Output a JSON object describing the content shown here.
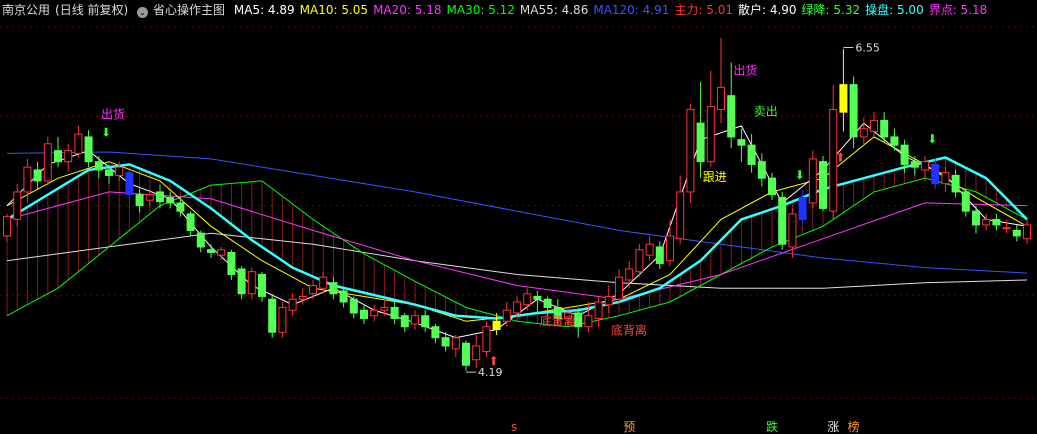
{
  "header": {
    "stock": "南京公用",
    "mode": "(日线 前复权)",
    "dropdown_glyph": "⌄",
    "indicator": "省心操作主图",
    "indicators": [
      {
        "label": "MA5:",
        "value": "4.89",
        "color": "#ffffff"
      },
      {
        "label": "MA10:",
        "value": "5.05",
        "color": "#ffff00"
      },
      {
        "label": "MA20:",
        "value": "5.18",
        "color": "#ff33ff"
      },
      {
        "label": "MA30:",
        "value": "5.12",
        "color": "#00ff00"
      },
      {
        "label": "MA55:",
        "value": "4.86",
        "color": "#dddddd"
      },
      {
        "label": "MA120:",
        "value": "4.91",
        "color": "#3355ff"
      },
      {
        "label": "主力:",
        "value": "5.01",
        "color": "#ff3333"
      },
      {
        "label": "散户:",
        "value": "4.90",
        "color": "#ffffff"
      },
      {
        "label": "绿降:",
        "value": "5.32",
        "color": "#33ff33"
      },
      {
        "label": "操盘:",
        "value": "5.00",
        "color": "#33ffff"
      },
      {
        "label": "界点:",
        "value": "5.18",
        "color": "#ff33ff"
      }
    ]
  },
  "colors": {
    "background": "#000000",
    "up": "#ff3232",
    "down": "#54ff54",
    "grid": "#7a0000",
    "ma5": "#ffffff",
    "ma10": "#ffff00",
    "ma20": "#ff33ff",
    "ma30": "#00ff00",
    "ma55": "#dddddd",
    "ma120": "#3355ff",
    "caopan": "#33ffff",
    "mark_yellow": "#ffff00",
    "mark_blue": "#2233ff",
    "label_pink": "#ff33ff",
    "label_red": "#ff4444",
    "label_green": "#33ff33",
    "label_yellow": "#ffff00",
    "label_orange": "#ff9933",
    "label_white": "#e6e6e6"
  },
  "chart_data": {
    "type": "candlestick",
    "ylim": [
      3.9,
      6.75
    ],
    "grid_levels": [
      4.0,
      4.75,
      5.4,
      6.05,
      6.7
    ],
    "candles": [
      [
        5.18,
        5.32,
        5.34,
        5.14
      ],
      [
        5.3,
        5.5,
        5.56,
        5.25
      ],
      [
        5.5,
        5.68,
        5.74,
        5.42
      ],
      [
        5.66,
        5.58,
        5.72,
        5.52
      ],
      [
        5.58,
        5.85,
        5.9,
        5.55
      ],
      [
        5.8,
        5.72,
        5.9,
        5.68
      ],
      [
        5.72,
        5.8,
        5.85,
        5.65
      ],
      [
        5.78,
        5.92,
        5.98,
        5.75
      ],
      [
        5.9,
        5.72,
        5.95,
        5.68
      ],
      [
        5.72,
        5.66,
        5.76,
        5.6
      ],
      [
        5.66,
        5.62,
        5.7,
        5.56
      ],
      [
        5.62,
        5.68,
        5.72,
        5.58
      ],
      [
        5.64,
        5.48,
        5.66,
        5.44
      ],
      [
        5.48,
        5.4,
        5.52,
        5.35
      ],
      [
        5.44,
        5.48,
        5.52,
        5.4
      ],
      [
        5.5,
        5.43,
        5.55,
        5.38
      ],
      [
        5.46,
        5.42,
        5.5,
        5.38
      ],
      [
        5.42,
        5.36,
        5.46,
        5.32
      ],
      [
        5.34,
        5.22,
        5.36,
        5.18
      ],
      [
        5.2,
        5.1,
        5.22,
        5.06
      ],
      [
        5.08,
        5.06,
        5.12,
        5.02
      ],
      [
        5.04,
        5.08,
        5.1,
        5.0
      ],
      [
        5.06,
        4.9,
        5.08,
        4.86
      ],
      [
        4.94,
        4.76,
        4.96,
        4.72
      ],
      [
        4.76,
        4.92,
        4.95,
        4.72
      ],
      [
        4.9,
        4.74,
        4.92,
        4.7
      ],
      [
        4.72,
        4.48,
        4.76,
        4.44
      ],
      [
        4.48,
        4.66,
        4.7,
        4.44
      ],
      [
        4.64,
        4.72,
        4.76,
        4.6
      ],
      [
        4.72,
        4.74,
        4.8,
        4.68
      ],
      [
        4.76,
        4.82,
        4.86,
        4.72
      ],
      [
        4.8,
        4.88,
        4.92,
        4.76
      ],
      [
        4.84,
        4.76,
        4.88,
        4.72
      ],
      [
        4.78,
        4.7,
        4.8,
        4.66
      ],
      [
        4.72,
        4.62,
        4.74,
        4.58
      ],
      [
        4.64,
        4.58,
        4.68,
        4.54
      ],
      [
        4.6,
        4.64,
        4.68,
        4.56
      ],
      [
        4.64,
        4.66,
        4.72,
        4.6
      ],
      [
        4.66,
        4.58,
        4.7,
        4.54
      ],
      [
        4.6,
        4.52,
        4.62,
        4.48
      ],
      [
        4.54,
        4.6,
        4.64,
        4.5
      ],
      [
        4.6,
        4.52,
        4.64,
        4.48
      ],
      [
        4.52,
        4.44,
        4.54,
        4.4
      ],
      [
        4.44,
        4.38,
        4.48,
        4.34
      ],
      [
        4.36,
        4.44,
        4.46,
        4.3
      ],
      [
        4.4,
        4.24,
        4.42,
        4.2
      ],
      [
        4.28,
        4.38,
        4.46,
        4.22
      ],
      [
        4.34,
        4.52,
        4.56,
        4.3
      ],
      [
        4.5,
        4.56,
        4.62,
        4.46
      ],
      [
        4.56,
        4.64,
        4.7,
        4.52
      ],
      [
        4.62,
        4.7,
        4.74,
        4.58
      ],
      [
        4.68,
        4.76,
        4.8,
        4.64
      ],
      [
        4.74,
        4.72,
        4.78,
        4.62
      ],
      [
        4.72,
        4.66,
        4.74,
        4.6
      ],
      [
        4.66,
        4.58,
        4.72,
        4.54
      ],
      [
        4.58,
        4.62,
        4.66,
        4.52
      ],
      [
        4.62,
        4.52,
        4.66,
        4.44
      ],
      [
        4.52,
        4.6,
        4.7,
        4.48
      ],
      [
        4.58,
        4.7,
        4.74,
        4.52
      ],
      [
        4.68,
        4.74,
        4.82,
        4.62
      ],
      [
        4.72,
        4.88,
        4.94,
        4.68
      ],
      [
        4.86,
        4.94,
        5.0,
        4.8
      ],
      [
        4.92,
        5.08,
        5.12,
        4.88
      ],
      [
        5.04,
        5.12,
        5.18,
        5.0
      ],
      [
        5.1,
        4.98,
        5.14,
        4.94
      ],
      [
        5.0,
        5.18,
        5.3,
        4.96
      ],
      [
        5.16,
        5.5,
        5.62,
        5.12
      ],
      [
        5.5,
        6.1,
        6.14,
        5.42
      ],
      [
        6.0,
        5.72,
        6.3,
        5.6
      ],
      [
        5.72,
        6.12,
        6.38,
        5.68
      ],
      [
        6.1,
        6.26,
        6.62,
        6.0
      ],
      [
        6.2,
        5.9,
        6.44,
        5.82
      ],
      [
        5.88,
        5.84,
        5.96,
        5.72
      ],
      [
        5.84,
        5.7,
        5.92,
        5.64
      ],
      [
        5.72,
        5.6,
        5.78,
        5.54
      ],
      [
        5.6,
        5.48,
        5.64,
        5.44
      ],
      [
        5.46,
        5.12,
        5.5,
        5.08
      ],
      [
        5.1,
        5.34,
        5.38,
        5.02
      ],
      [
        5.3,
        5.46,
        5.52,
        5.26
      ],
      [
        5.42,
        5.74,
        5.8,
        5.38
      ],
      [
        5.72,
        5.38,
        5.76,
        5.36
      ],
      [
        5.36,
        6.1,
        6.28,
        5.3
      ],
      [
        6.08,
        6.28,
        6.54,
        5.94
      ],
      [
        6.28,
        5.9,
        6.34,
        5.82
      ],
      [
        5.9,
        5.96,
        6.04,
        5.84
      ],
      [
        5.94,
        6.02,
        6.08,
        5.9
      ],
      [
        6.02,
        5.9,
        6.08,
        5.86
      ],
      [
        5.9,
        5.84,
        5.96,
        5.8
      ],
      [
        5.84,
        5.7,
        5.88,
        5.64
      ],
      [
        5.72,
        5.68,
        5.76,
        5.62
      ],
      [
        5.66,
        5.72,
        5.76,
        5.58
      ],
      [
        5.7,
        5.56,
        5.74,
        5.52
      ],
      [
        5.56,
        5.64,
        5.68,
        5.5
      ],
      [
        5.62,
        5.5,
        5.66,
        5.46
      ],
      [
        5.5,
        5.36,
        5.52,
        5.32
      ],
      [
        5.36,
        5.26,
        5.4,
        5.2
      ],
      [
        5.26,
        5.3,
        5.34,
        5.22
      ],
      [
        5.3,
        5.26,
        5.34,
        5.22
      ],
      [
        5.24,
        5.24,
        5.3,
        5.2
      ],
      [
        5.22,
        5.18,
        5.26,
        5.14
      ],
      [
        5.16,
        5.26,
        5.3,
        5.12
      ]
    ],
    "marked_candles": [
      {
        "index": 12,
        "color": "mark_blue"
      },
      {
        "index": 48,
        "color": "mark_yellow"
      },
      {
        "index": 78,
        "color": "mark_blue"
      },
      {
        "index": 82,
        "color": "mark_yellow"
      },
      {
        "index": 91,
        "color": "mark_blue"
      }
    ],
    "extremes": [
      {
        "index": 82,
        "price": 6.55,
        "label": "6.55",
        "side": "high"
      },
      {
        "index": 45,
        "price": 4.19,
        "label": "4.19",
        "side": "low"
      }
    ],
    "ma120": [
      [
        0,
        5.78
      ],
      [
        10,
        5.79
      ],
      [
        20,
        5.74
      ],
      [
        30,
        5.62
      ],
      [
        40,
        5.5
      ],
      [
        50,
        5.36
      ],
      [
        60,
        5.22
      ],
      [
        70,
        5.12
      ],
      [
        80,
        5.02
      ],
      [
        90,
        4.95
      ],
      [
        100,
        4.91
      ]
    ],
    "ma55": [
      [
        0,
        5.0
      ],
      [
        10,
        5.1
      ],
      [
        20,
        5.2
      ],
      [
        30,
        5.12
      ],
      [
        40,
        5.0
      ],
      [
        50,
        4.9
      ],
      [
        60,
        4.84
      ],
      [
        70,
        4.8
      ],
      [
        80,
        4.8
      ],
      [
        90,
        4.84
      ],
      [
        100,
        4.86
      ]
    ],
    "ma30": [
      [
        0,
        4.6
      ],
      [
        5,
        4.8
      ],
      [
        10,
        5.1
      ],
      [
        15,
        5.4
      ],
      [
        20,
        5.55
      ],
      [
        25,
        5.58
      ],
      [
        30,
        5.3
      ],
      [
        35,
        5.05
      ],
      [
        40,
        4.85
      ],
      [
        45,
        4.66
      ],
      [
        50,
        4.56
      ],
      [
        55,
        4.52
      ],
      [
        60,
        4.6
      ],
      [
        65,
        4.7
      ],
      [
        70,
        4.9
      ],
      [
        75,
        5.1
      ],
      [
        80,
        5.25
      ],
      [
        85,
        5.5
      ],
      [
        90,
        5.6
      ],
      [
        95,
        5.5
      ],
      [
        100,
        5.3
      ]
    ],
    "ma20": [
      [
        0,
        5.3
      ],
      [
        10,
        5.5
      ],
      [
        20,
        5.45
      ],
      [
        30,
        5.22
      ],
      [
        40,
        5.0
      ],
      [
        50,
        4.82
      ],
      [
        60,
        4.72
      ],
      [
        70,
        4.9
      ],
      [
        80,
        5.16
      ],
      [
        90,
        5.42
      ],
      [
        100,
        5.4
      ]
    ],
    "ma10": [
      [
        0,
        5.4
      ],
      [
        5,
        5.6
      ],
      [
        10,
        5.72
      ],
      [
        15,
        5.58
      ],
      [
        20,
        5.25
      ],
      [
        25,
        5.0
      ],
      [
        30,
        4.8
      ],
      [
        35,
        4.74
      ],
      [
        40,
        4.68
      ],
      [
        45,
        4.56
      ],
      [
        50,
        4.6
      ],
      [
        55,
        4.66
      ],
      [
        60,
        4.72
      ],
      [
        65,
        4.9
      ],
      [
        70,
        5.3
      ],
      [
        75,
        5.5
      ],
      [
        80,
        5.6
      ],
      [
        85,
        5.9
      ],
      [
        90,
        5.7
      ],
      [
        95,
        5.46
      ],
      [
        100,
        5.25
      ]
    ],
    "ma5": [
      [
        0,
        5.4
      ],
      [
        4,
        5.7
      ],
      [
        8,
        5.8
      ],
      [
        12,
        5.56
      ],
      [
        16,
        5.45
      ],
      [
        20,
        5.1
      ],
      [
        24,
        4.82
      ],
      [
        28,
        4.68
      ],
      [
        32,
        4.8
      ],
      [
        36,
        4.64
      ],
      [
        40,
        4.55
      ],
      [
        44,
        4.44
      ],
      [
        48,
        4.5
      ],
      [
        52,
        4.72
      ],
      [
        56,
        4.6
      ],
      [
        60,
        4.76
      ],
      [
        64,
        5.04
      ],
      [
        68,
        5.88
      ],
      [
        72,
        5.98
      ],
      [
        76,
        5.42
      ],
      [
        80,
        5.66
      ],
      [
        84,
        6.0
      ],
      [
        88,
        5.76
      ],
      [
        92,
        5.62
      ],
      [
        96,
        5.3
      ],
      [
        100,
        5.25
      ]
    ],
    "caopan": [
      [
        0,
        5.3
      ],
      [
        4,
        5.48
      ],
      [
        8,
        5.66
      ],
      [
        12,
        5.7
      ],
      [
        16,
        5.58
      ],
      [
        20,
        5.38
      ],
      [
        24,
        5.15
      ],
      [
        28,
        4.95
      ],
      [
        32,
        4.82
      ],
      [
        36,
        4.75
      ],
      [
        40,
        4.68
      ],
      [
        44,
        4.6
      ],
      [
        48,
        4.58
      ],
      [
        52,
        4.62
      ],
      [
        56,
        4.64
      ],
      [
        60,
        4.7
      ],
      [
        64,
        4.8
      ],
      [
        68,
        5.0
      ],
      [
        72,
        5.3
      ],
      [
        76,
        5.4
      ],
      [
        80,
        5.52
      ],
      [
        84,
        5.6
      ],
      [
        88,
        5.68
      ],
      [
        92,
        5.75
      ],
      [
        96,
        5.6
      ],
      [
        100,
        5.3
      ]
    ],
    "signals": [
      {
        "index": 10,
        "text": "出货",
        "color": "label_pink",
        "dy": -46
      },
      {
        "index": 10,
        "text": "⬇",
        "color": "label_green",
        "dy": -28
      },
      {
        "index": 48,
        "text": "⬆",
        "color": "label_red",
        "dy": 30
      },
      {
        "index": 53,
        "text": "底背离",
        "color": "label_red",
        "dy": 10
      },
      {
        "index": 60,
        "text": "底背离",
        "color": "label_red",
        "dy": 30
      },
      {
        "index": 69,
        "text": "跟进",
        "color": "label_yellow",
        "dy": 14
      },
      {
        "index": 72,
        "text": "出货",
        "color": "label_pink",
        "dy": -54
      },
      {
        "index": 74,
        "text": "卖出",
        "color": "label_green",
        "dy": -38
      },
      {
        "index": 82,
        "text": "⬆",
        "color": "label_red",
        "dy": 30
      },
      {
        "index": 78,
        "text": "⬇",
        "color": "label_green",
        "dy": -10
      },
      {
        "index": 91,
        "text": "⬇",
        "color": "label_green",
        "dy": -16
      }
    ],
    "bottom_markers": [
      {
        "index": 50,
        "text": "s",
        "color": "label_red"
      },
      {
        "index": 61,
        "text": "预",
        "color": "label_orange"
      },
      {
        "index": 75,
        "text": "跌",
        "color": "label_green"
      },
      {
        "index": 81,
        "text": "涨",
        "color": "label_white"
      },
      {
        "index": 83,
        "text": "榜",
        "color": "label_orange"
      }
    ]
  }
}
